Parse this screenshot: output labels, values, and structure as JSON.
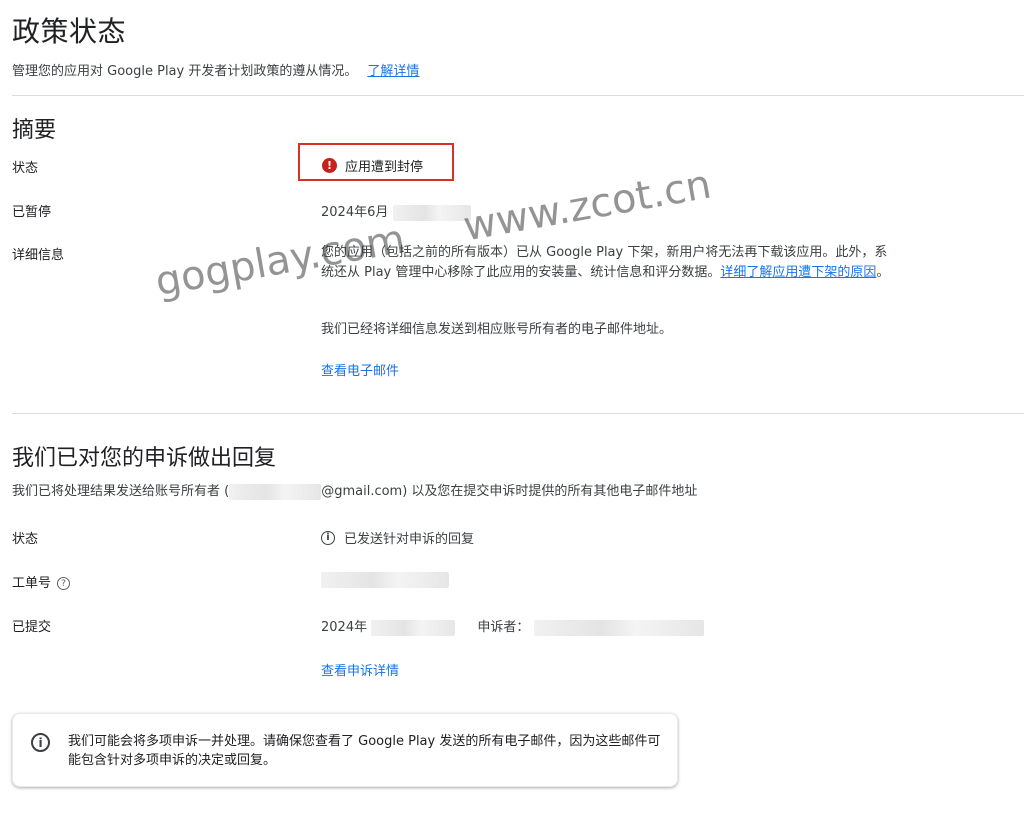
{
  "header": {
    "title": "政策状态",
    "subtitle": "管理您的应用对 Google Play 开发者计划政策的遵从情况。",
    "learn_more": "了解详情"
  },
  "summary": {
    "title": "摘要",
    "status_label": "状态",
    "status_value": "应用遭到封停",
    "suspended_label": "已暂停",
    "suspended_date": "2024年6月",
    "details_label": "详细信息",
    "details_text": "您的应用（包括之前的所有版本）已从 Google Play 下架，新用户将无法再下载该应用。此外，系统还从 Play 管理中心移除了此应用的安装量、统计信息和评分数据。",
    "details_link": "详细了解应用遭下架的原因",
    "details_end": "。",
    "email_notice": "我们已经将详细信息发送到相应账号所有者的电子邮件地址。",
    "view_email": "查看电子邮件"
  },
  "appeal": {
    "title": "我们已对您的申诉做出回复",
    "sent_prefix": "我们已将处理结果发送给账号所有者 (",
    "sent_suffix": "@gmail.com) 以及您在提交申诉时提供的所有其他电子邮件地址",
    "status_label": "状态",
    "status_value": "已发送针对申诉的回复",
    "ticket_label": "工单号",
    "submitted_label": "已提交",
    "submitted_date": "2024年",
    "appellant_label": "申诉者：",
    "view_details": "查看申诉详情"
  },
  "info_card": {
    "text": "我们可能会将多项申诉一并处理。请确保您查看了 Google Play 发送的所有电子邮件，因为这些邮件可能包含针对多项申诉的决定或回复。"
  },
  "watermarks": [
    "gogplay.com",
    "www.zcot.cn"
  ],
  "colors": {
    "link": "#1a73e8",
    "error": "#c5221f",
    "highlight_border": "#d93025",
    "divider": "#dadce0"
  }
}
